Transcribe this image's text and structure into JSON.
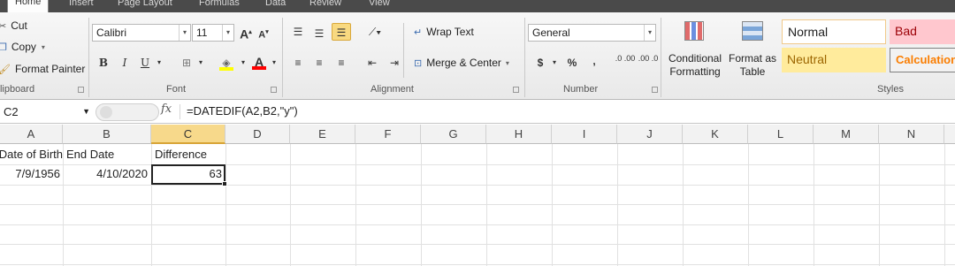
{
  "tabs": [
    "Home",
    "Insert",
    "Page Layout",
    "Formulas",
    "Data",
    "Review",
    "View"
  ],
  "clipboard": {
    "cut": "Cut",
    "copy": "Copy",
    "format_painter": "Format Painter",
    "label": "Clipboard"
  },
  "font": {
    "name": "Calibri",
    "size": "11",
    "grow": "A",
    "shrink": "A",
    "bold": "B",
    "italic": "I",
    "underline": "U",
    "label": "Font",
    "fill_color": "#FFFF00",
    "text_color": "#FF0000"
  },
  "alignment": {
    "wrap_text": "Wrap Text",
    "merge_center": "Merge & Center",
    "label": "Alignment"
  },
  "number": {
    "format": "General",
    "currency": "$",
    "percent": "%",
    "comma": ",",
    "inc_decimal": ".0 .00",
    "dec_decimal": ".00 .0",
    "label": "Number"
  },
  "styles": {
    "conditional": "Conditional Formatting",
    "format_table": "Format as Table",
    "normal": "Normal",
    "bad": "Bad",
    "neutral": "Neutral",
    "calculation": "Calculation",
    "label": "Styles"
  },
  "formula_bar": {
    "name_box": "C2",
    "fx": "fx",
    "formula": "=DATEDIF(A2,B2,\"y\")"
  },
  "columns": [
    "A",
    "B",
    "C",
    "D",
    "E",
    "F",
    "G",
    "H",
    "I",
    "J",
    "K",
    "L",
    "M",
    "N"
  ],
  "sheet": {
    "row1": [
      "Date of Birth",
      "End Date",
      "Difference"
    ],
    "row2": [
      "7/9/1956",
      "4/10/2020",
      "63"
    ]
  },
  "colors": {
    "selection": "#F7D98B",
    "ribbon_tab": "#4A4A4A"
  }
}
